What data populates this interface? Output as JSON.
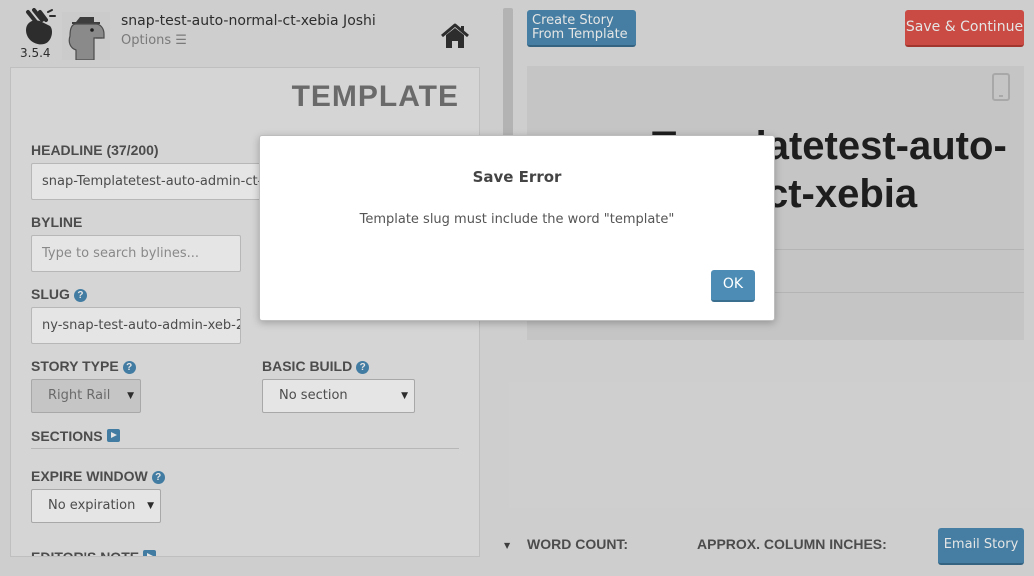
{
  "app": {
    "version": "3.5.4",
    "user_name": "snap-test-auto-normal-ct-xebia Joshi",
    "options_label": "Options ☰"
  },
  "form": {
    "title": "TEMPLATE",
    "headline_label": "HEADLINE (37/200)",
    "headline_value": "snap-Templatetest-auto-admin-ct-xebia",
    "byline_label": "BYLINE",
    "byline_placeholder": "Type to search bylines...",
    "slug_label": "SLUG",
    "slug_value": "ny-snap-test-auto-admin-xeb-2",
    "story_type_label": "STORY TYPE",
    "story_type_value": "Right Rail",
    "basic_build_label": "BASIC BUILD",
    "basic_build_value": "No section",
    "sections_label": "SECTIONS",
    "expire_window_label": "EXPIRE WINDOW",
    "expire_window_value": "No expiration",
    "editors_note_label": "EDITOR'S NOTE"
  },
  "toolbar": {
    "create_line1": "Create Story",
    "create_line2": "From Template",
    "save_continue": "Save & Continue"
  },
  "preview": {
    "headline_line1": "snap-Templatetest-auto-",
    "headline_line2": "admin-ct-xebia"
  },
  "footer": {
    "word_count_label": "WORD COUNT:",
    "column_inches_label": "APPROX. COLUMN INCHES:",
    "email_story": "Email Story"
  },
  "modal": {
    "title": "Save Error",
    "message": "Template slug must include the word \"template\"",
    "ok": "OK"
  },
  "colors": {
    "accent_blue": "#4d8db5",
    "save_red": "#e0544b"
  }
}
